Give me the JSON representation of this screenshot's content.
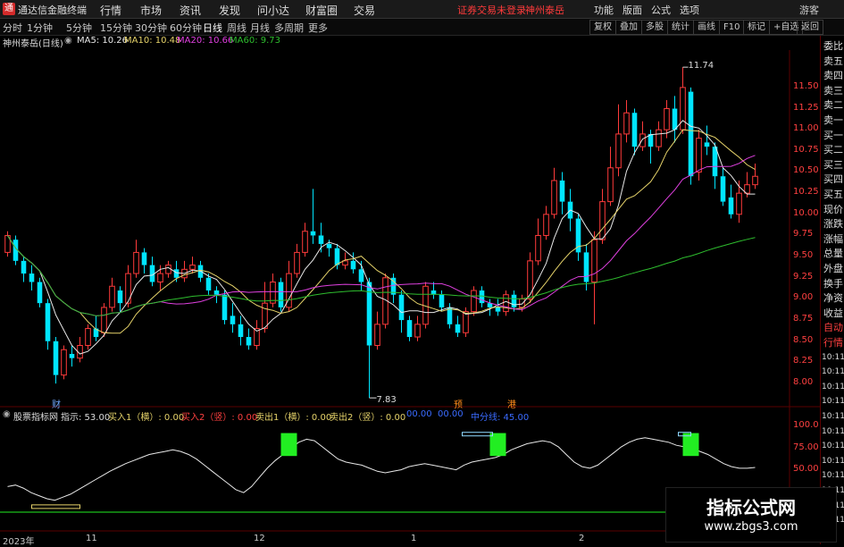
{
  "titlebar": {
    "logo": "通",
    "app_name": "通达信金融终端",
    "menus": [
      "行情",
      "市场",
      "资讯",
      "发现",
      "问小达",
      "财富圈",
      "交易"
    ],
    "login_warning": "证券交易未登录",
    "stock_name": "神州泰岳",
    "right_menus": [
      "功能",
      "版面",
      "公式",
      "选项"
    ],
    "window_label": "游客"
  },
  "period_bar": {
    "periods": [
      "分时",
      "1分钟",
      "5分钟",
      "15分钟",
      "30分钟",
      "60分钟",
      "日线",
      "周线",
      "月线",
      "多周期",
      "更多"
    ],
    "active": "日线",
    "tools": [
      "复权",
      "叠加",
      "多股",
      "统计",
      "画线",
      "F10",
      "标记",
      "+自选",
      "返回"
    ]
  },
  "price_header": {
    "stock": "神州泰岳(日线)",
    "ma5": "MA5: 10.26",
    "ma10": "MA10: 10.48",
    "ma20": "MA20: 10.66",
    "ma60": "MA60: 9.73"
  },
  "colors": {
    "up": "#ff3b3b",
    "down": "#00e5ff",
    "ma5": "#e8e8e8",
    "ma10": "#e6d36a",
    "ma20": "#e040e0",
    "ma60": "#2ebd2e",
    "axis": "#ff4040",
    "signal": "#22ee22"
  },
  "price_axis": [
    "11.50",
    "11.25",
    "11.00",
    "10.75",
    "10.50",
    "10.25",
    "10.00",
    "9.75",
    "9.50",
    "9.25",
    "9.00",
    "8.75",
    "8.50",
    "8.25",
    "8.00"
  ],
  "annotations": {
    "high": "11.74",
    "low": "7.83"
  },
  "markers": [
    "财",
    "预",
    "港"
  ],
  "indicator_header": {
    "name": "股票指标网",
    "hint": "指示: 53.00",
    "buy1": "买入1（横）: 0.00",
    "buy2": "买入2（竖）: 0.00",
    "sell1": "卖出1（横）: 0.00",
    "sell2": "卖出2（竖）: 0.00",
    "extra1": "00.00",
    "extra2": "00.00",
    "mid": "中分线: 45.00"
  },
  "indicator_axis": [
    "100.0",
    "75.00",
    "50.00"
  ],
  "date_axis": [
    "2023年",
    "11",
    "12",
    "1",
    "2"
  ],
  "right_panel": [
    "委比",
    "卖五",
    "卖四",
    "卖三",
    "卖二",
    "卖一",
    "买一",
    "买二",
    "买三",
    "买四",
    "买五",
    "现价",
    "涨跌",
    "涨幅",
    "总量",
    "外盘",
    "换手",
    "净资",
    "收益",
    "自动",
    "行情",
    "10:11",
    "10:11",
    "10:11",
    "10:11",
    "10:11",
    "10:11",
    "10:11",
    "10:11",
    "10:11",
    "10:11",
    "10:11",
    "10:11"
  ],
  "watermark": {
    "title": "指标公式网",
    "url": "www.zbgs3.com"
  },
  "chart_data": {
    "type": "candlestick",
    "ylim": [
      7.8,
      11.9
    ],
    "candles": [
      [
        9.55,
        9.75,
        9.8,
        9.5
      ],
      [
        9.7,
        9.45,
        9.75,
        9.4
      ],
      [
        9.45,
        9.3,
        9.5,
        9.2
      ],
      [
        9.3,
        9.2,
        9.4,
        9.1
      ],
      [
        9.2,
        8.95,
        9.25,
        8.9
      ],
      [
        8.95,
        8.5,
        9.0,
        8.4
      ],
      [
        8.5,
        8.1,
        8.55,
        8.0
      ],
      [
        8.1,
        8.4,
        8.45,
        8.05
      ],
      [
        8.35,
        8.3,
        8.45,
        8.2
      ],
      [
        8.3,
        8.45,
        8.55,
        8.25
      ],
      [
        8.45,
        8.65,
        8.7,
        8.4
      ],
      [
        8.65,
        8.55,
        8.8,
        8.5
      ],
      [
        8.6,
        8.9,
        8.95,
        8.55
      ],
      [
        8.9,
        9.15,
        9.25,
        8.85
      ],
      [
        9.1,
        8.95,
        9.15,
        8.85
      ],
      [
        8.95,
        9.3,
        9.4,
        8.9
      ],
      [
        9.3,
        9.55,
        9.7,
        9.25
      ],
      [
        9.55,
        9.4,
        9.6,
        9.3
      ],
      [
        9.4,
        9.2,
        9.5,
        9.15
      ],
      [
        9.2,
        9.3,
        9.4,
        9.1
      ],
      [
        9.3,
        9.4,
        9.45,
        9.25
      ],
      [
        9.35,
        9.25,
        9.45,
        9.2
      ],
      [
        9.25,
        9.35,
        9.45,
        9.2
      ],
      [
        9.35,
        9.4,
        9.5,
        9.3
      ],
      [
        9.4,
        9.25,
        9.45,
        9.2
      ],
      [
        9.25,
        9.1,
        9.3,
        9.05
      ],
      [
        9.1,
        9.05,
        9.15,
        8.95
      ],
      [
        9.05,
        8.75,
        9.1,
        8.7
      ],
      [
        8.8,
        8.7,
        8.95,
        8.6
      ],
      [
        8.7,
        8.55,
        8.8,
        8.45
      ],
      [
        8.55,
        8.45,
        8.65,
        8.4
      ],
      [
        8.45,
        8.65,
        8.75,
        8.4
      ],
      [
        8.65,
        8.95,
        9.2,
        8.6
      ],
      [
        8.95,
        9.2,
        9.3,
        8.9
      ],
      [
        9.2,
        8.9,
        9.25,
        8.85
      ],
      [
        8.9,
        9.3,
        9.45,
        8.85
      ],
      [
        9.3,
        9.55,
        9.65,
        9.25
      ],
      [
        9.55,
        9.8,
        9.9,
        9.5
      ],
      [
        9.8,
        9.75,
        10.3,
        9.65
      ],
      [
        9.75,
        9.65,
        9.9,
        9.55
      ],
      [
        9.65,
        9.6,
        9.7,
        9.5
      ],
      [
        9.6,
        9.4,
        9.65,
        9.35
      ],
      [
        9.4,
        9.45,
        9.55,
        9.35
      ],
      [
        9.45,
        9.35,
        9.55,
        9.3
      ],
      [
        9.35,
        9.2,
        9.45,
        9.1
      ],
      [
        9.2,
        8.45,
        9.25,
        7.83
      ],
      [
        8.45,
        8.7,
        8.85,
        8.4
      ],
      [
        8.7,
        9.25,
        9.3,
        8.65
      ],
      [
        9.25,
        9.05,
        9.3,
        8.95
      ],
      [
        9.05,
        8.75,
        9.1,
        8.6
      ],
      [
        8.75,
        8.55,
        8.8,
        8.5
      ],
      [
        8.55,
        8.7,
        8.8,
        8.5
      ],
      [
        8.7,
        9.15,
        9.2,
        8.65
      ],
      [
        9.1,
        9.05,
        9.2,
        9.0
      ],
      [
        9.05,
        8.9,
        9.1,
        8.85
      ],
      [
        8.9,
        8.7,
        8.95,
        8.65
      ],
      [
        8.7,
        8.6,
        8.8,
        8.55
      ],
      [
        8.6,
        8.85,
        8.9,
        8.55
      ],
      [
        8.85,
        9.1,
        9.15,
        8.8
      ],
      [
        9.1,
        8.95,
        9.15,
        8.9
      ],
      [
        8.95,
        8.9,
        9.0,
        8.8
      ],
      [
        8.9,
        8.85,
        9.0,
        8.8
      ],
      [
        8.85,
        9.05,
        9.1,
        8.8
      ],
      [
        9.05,
        8.9,
        9.1,
        8.85
      ],
      [
        8.9,
        9.0,
        9.05,
        8.85
      ],
      [
        9.0,
        9.45,
        9.55,
        8.95
      ],
      [
        9.45,
        9.75,
        9.95,
        9.4
      ],
      [
        9.75,
        10.0,
        10.1,
        9.7
      ],
      [
        10.0,
        10.4,
        10.55,
        9.95
      ],
      [
        10.4,
        10.15,
        10.5,
        10.0
      ],
      [
        10.15,
        9.95,
        10.3,
        9.8
      ],
      [
        9.95,
        9.55,
        10.0,
        9.45
      ],
      [
        9.55,
        9.2,
        9.65,
        9.1
      ],
      [
        9.2,
        9.7,
        9.8,
        8.7
      ],
      [
        9.7,
        10.15,
        10.3,
        9.65
      ],
      [
        10.15,
        10.55,
        10.8,
        10.1
      ],
      [
        10.55,
        10.95,
        11.3,
        10.45
      ],
      [
        10.95,
        11.2,
        11.35,
        10.85
      ],
      [
        11.2,
        10.8,
        11.25,
        10.7
      ],
      [
        10.8,
        10.95,
        11.1,
        10.75
      ],
      [
        10.95,
        10.8,
        11.0,
        10.6
      ],
      [
        10.8,
        11.0,
        11.1,
        10.75
      ],
      [
        11.0,
        11.25,
        11.35,
        10.9
      ],
      [
        11.25,
        11.0,
        11.4,
        10.85
      ],
      [
        11.0,
        11.5,
        11.74,
        10.95
      ],
      [
        11.45,
        10.45,
        11.5,
        10.35
      ],
      [
        10.5,
        10.9,
        11.0,
        10.4
      ],
      [
        10.85,
        10.8,
        11.05,
        10.7
      ],
      [
        10.8,
        10.45,
        10.85,
        10.3
      ],
      [
        10.45,
        10.15,
        10.55,
        10.1
      ],
      [
        10.2,
        10.0,
        10.35,
        9.95
      ],
      [
        10.0,
        10.25,
        10.4,
        9.9
      ],
      [
        10.25,
        10.35,
        10.5,
        10.2
      ],
      [
        10.35,
        10.45,
        10.6,
        10.3
      ]
    ],
    "oscillator": [
      30,
      32,
      28,
      22,
      18,
      14,
      12,
      16,
      20,
      26,
      32,
      38,
      44,
      50,
      55,
      60,
      64,
      68,
      72,
      74,
      76,
      78,
      76,
      72,
      66,
      58,
      50,
      42,
      34,
      26,
      22,
      30,
      42,
      54,
      64,
      72,
      80,
      88,
      92,
      90,
      82,
      74,
      66,
      62,
      60,
      58,
      54,
      50,
      48,
      50,
      52,
      56,
      58,
      60,
      58,
      56,
      54,
      52,
      58,
      62,
      64,
      66,
      68,
      72,
      78,
      82,
      86,
      88,
      90,
      88,
      82,
      72,
      62,
      56,
      54,
      58,
      66,
      74,
      82,
      88,
      92,
      94,
      92,
      90,
      88,
      84,
      82,
      80,
      76,
      72,
      66,
      60,
      56,
      54,
      54,
      55
    ],
    "signals_x": [
      35,
      61,
      85
    ]
  }
}
